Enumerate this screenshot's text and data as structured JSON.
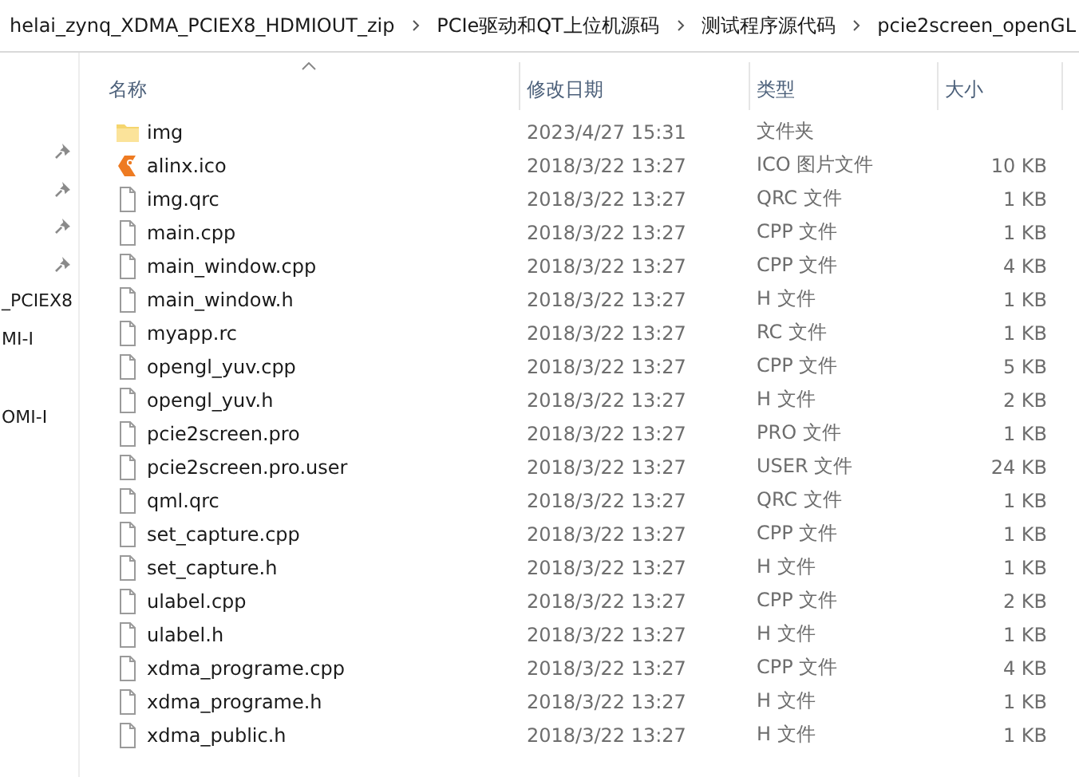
{
  "breadcrumb": [
    {
      "label": "helai_zynq_XDMA_PCIEX8_HDMIOUT_zip"
    },
    {
      "label": "PCIe驱动和QT上位机源码"
    },
    {
      "label": "测试程序源代码"
    },
    {
      "label": "pcie2screen_openGL"
    }
  ],
  "sidebar": {
    "items": [
      {
        "pinned": true
      },
      {
        "pinned": true
      },
      {
        "pinned": true
      },
      {
        "pinned": true
      },
      {
        "label": "_PCIEX8",
        "pinned": false
      },
      {
        "label": "MI-I",
        "pinned": false
      },
      {
        "label": "OMI-I",
        "pinned": false
      }
    ]
  },
  "table": {
    "columns": [
      {
        "label": "名称",
        "sorted": true
      },
      {
        "label": "修改日期",
        "sorted": false
      },
      {
        "label": "类型",
        "sorted": false
      },
      {
        "label": "大小",
        "sorted": false
      }
    ],
    "rows": [
      {
        "kind": "folder",
        "name": "img",
        "modified": "2023/4/27 15:31",
        "type": "文件夹"
      },
      {
        "kind": "ico",
        "name": "alinx.ico",
        "modified": "2018/3/22 13:27",
        "type": "ICO 图片文件",
        "size": "10 KB"
      },
      {
        "kind": "file",
        "name": "img.qrc",
        "modified": "2018/3/22 13:27",
        "type": "QRC 文件",
        "size": "1 KB"
      },
      {
        "kind": "file",
        "name": "main.cpp",
        "modified": "2018/3/22 13:27",
        "type": "CPP 文件",
        "size": "1 KB"
      },
      {
        "kind": "file",
        "name": "main_window.cpp",
        "modified": "2018/3/22 13:27",
        "type": "CPP 文件",
        "size": "4 KB"
      },
      {
        "kind": "file",
        "name": "main_window.h",
        "modified": "2018/3/22 13:27",
        "type": "H 文件",
        "size": "1 KB"
      },
      {
        "kind": "file",
        "name": "myapp.rc",
        "modified": "2018/3/22 13:27",
        "type": "RC 文件",
        "size": "1 KB"
      },
      {
        "kind": "file",
        "name": "opengl_yuv.cpp",
        "modified": "2018/3/22 13:27",
        "type": "CPP 文件",
        "size": "5 KB"
      },
      {
        "kind": "file",
        "name": "opengl_yuv.h",
        "modified": "2018/3/22 13:27",
        "type": "H 文件",
        "size": "2 KB"
      },
      {
        "kind": "file",
        "name": "pcie2screen.pro",
        "modified": "2018/3/22 13:27",
        "type": "PRO 文件",
        "size": "1 KB"
      },
      {
        "kind": "file",
        "name": "pcie2screen.pro.user",
        "modified": "2018/3/22 13:27",
        "type": "USER 文件",
        "size": "24 KB"
      },
      {
        "kind": "file",
        "name": "qml.qrc",
        "modified": "2018/3/22 13:27",
        "type": "QRC 文件",
        "size": "1 KB"
      },
      {
        "kind": "file",
        "name": "set_capture.cpp",
        "modified": "2018/3/22 13:27",
        "type": "CPP 文件",
        "size": "1 KB"
      },
      {
        "kind": "file",
        "name": "set_capture.h",
        "modified": "2018/3/22 13:27",
        "type": "H 文件",
        "size": "1 KB"
      },
      {
        "kind": "file",
        "name": "ulabel.cpp",
        "modified": "2018/3/22 13:27",
        "type": "CPP 文件",
        "size": "2 KB"
      },
      {
        "kind": "file",
        "name": "ulabel.h",
        "modified": "2018/3/22 13:27",
        "type": "H 文件",
        "size": "1 KB"
      },
      {
        "kind": "file",
        "name": "xdma_programe.cpp",
        "modified": "2018/3/22 13:27",
        "type": "CPP 文件",
        "size": "4 KB"
      },
      {
        "kind": "file",
        "name": "xdma_programe.h",
        "modified": "2018/3/22 13:27",
        "type": "H 文件",
        "size": "1 KB"
      },
      {
        "kind": "file",
        "name": "xdma_public.h",
        "modified": "2018/3/22 13:27",
        "type": "H 文件",
        "size": "1 KB"
      }
    ]
  }
}
